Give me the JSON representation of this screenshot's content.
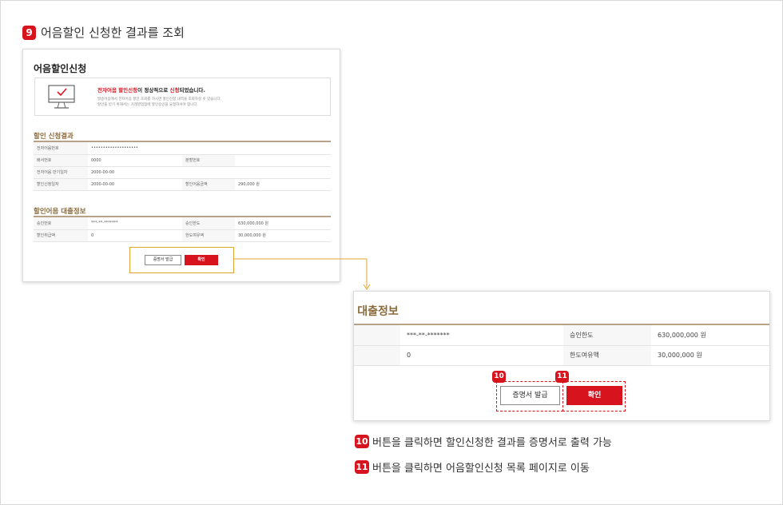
{
  "step": {
    "number": "9",
    "title": "어음할인 신청한 결과를 조회"
  },
  "screenshot": {
    "page_title": "어음할인신청",
    "notice": {
      "main_red1": "전자어음 할인신청",
      "main_mid": "이 정상적으로 ",
      "main_red2": "신청",
      "main_end": "되었습니다.",
      "sub1": "발송어음에서 전자어음 할인 조회를 하시면 할인신청 내역을 조회하실 수 있습니다.",
      "sub2": "할인을 받기 위해서는 거래영업점에 할인승인을 요청하셔야 합니다."
    },
    "result_section": {
      "title": "할인 신청결과",
      "rows": [
        [
          "전자어음번호",
          "••••••••••••••••••••",
          "",
          ""
        ],
        [
          "배서번호",
          "0000",
          "분할번호",
          ""
        ],
        [
          "전자어음 만기일자",
          "2000-00-00",
          "",
          ""
        ],
        [
          "할인신청일자",
          "2000-00-00",
          "할인어음금액",
          "290,000 원"
        ]
      ]
    },
    "loan_section": {
      "title": "할인어음 대출정보",
      "rows": [
        [
          "승인번호",
          "***-**-*******",
          "승인한도",
          "630,000,000 원"
        ],
        [
          "할인취급액",
          "0",
          "한도여유액",
          "30,000,000 원"
        ]
      ]
    },
    "buttons": {
      "certificate": "증명서 발급",
      "confirm": "확인"
    }
  },
  "zoom": {
    "section_title": "· 대출정보",
    "rows": [
      [
        "",
        "***-**-*******",
        "승인한도",
        "630,000,000 원"
      ],
      [
        "",
        "0",
        "한도여유액",
        "30,000,000 원"
      ]
    ],
    "buttons": {
      "certificate": "증명서 발급",
      "confirm": "확인"
    },
    "badges": {
      "certificate": "10",
      "confirm": "11"
    }
  },
  "legend": [
    {
      "number": "10",
      "text": "버튼을 클릭하면 할인신청한 결과를 증명서로 출력 가능"
    },
    {
      "number": "11",
      "text": "버튼을 클릭하면 어음할인신청 목록 페이지로 이동"
    }
  ],
  "colors": {
    "accent_red": "#d7131e",
    "section_brown": "#8a6a3c",
    "highlight_orange": "#e0a530"
  }
}
